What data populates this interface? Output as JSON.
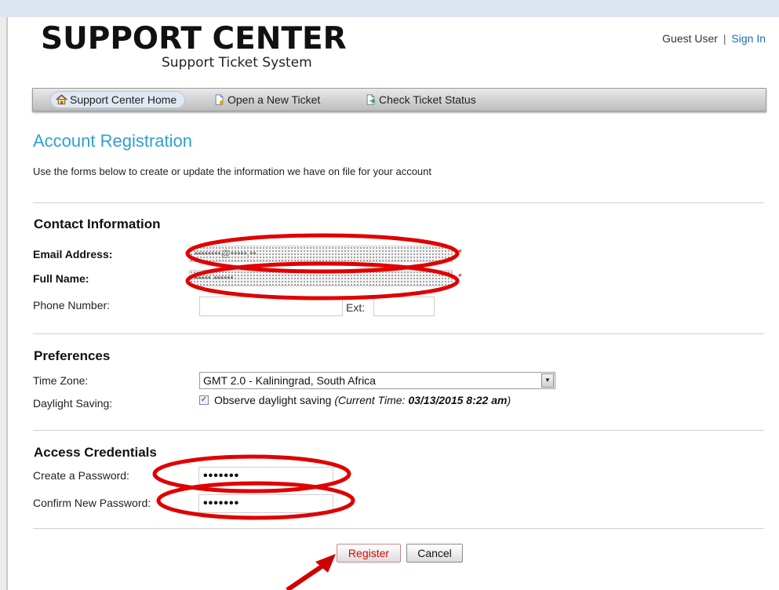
{
  "header": {
    "logo_title": "SUPPORT CENTER",
    "logo_subtitle": "Support Ticket System",
    "user_label": "Guest User",
    "separator": "|",
    "sign_in": "Sign In"
  },
  "nav": {
    "items": [
      {
        "label": "Support Center Home",
        "icon": "home-icon"
      },
      {
        "label": "Open a New Ticket",
        "icon": "new-ticket-icon"
      },
      {
        "label": "Check Ticket Status",
        "icon": "ticket-status-icon"
      }
    ]
  },
  "page": {
    "title": "Account Registration",
    "intro": "Use the forms below to create or update the information we have on file for your account"
  },
  "contact": {
    "title": "Contact Information",
    "email_label": "Email Address:",
    "email_value": "••••••••@•••••.••",
    "name_label": "Full Name:",
    "name_value": "••••• ••••••",
    "phone_label": "Phone Number:",
    "phone_value": "",
    "ext_label": "Ext:",
    "ext_value": "",
    "required_mark": "*"
  },
  "preferences": {
    "title": "Preferences",
    "timezone_label": "Time Zone:",
    "timezone_value": "GMT 2.0 - Kaliningrad, South Africa",
    "dst_label": "Daylight Saving:",
    "dst_checked": true,
    "dst_text": "Observe daylight saving",
    "current_time_prefix": "(Current Time:",
    "current_time_value": "03/13/2015 8:22 am",
    "current_time_suffix": ")"
  },
  "credentials": {
    "title": "Access Credentials",
    "password_label": "Create a Password:",
    "password_value": "•••••••",
    "confirm_label": "Confirm New Password:",
    "confirm_value": "•••••••"
  },
  "actions": {
    "register": "Register",
    "cancel": "Cancel"
  },
  "annotations": {
    "ellipse_color": "#e00000",
    "arrow_color": "#d00000"
  }
}
